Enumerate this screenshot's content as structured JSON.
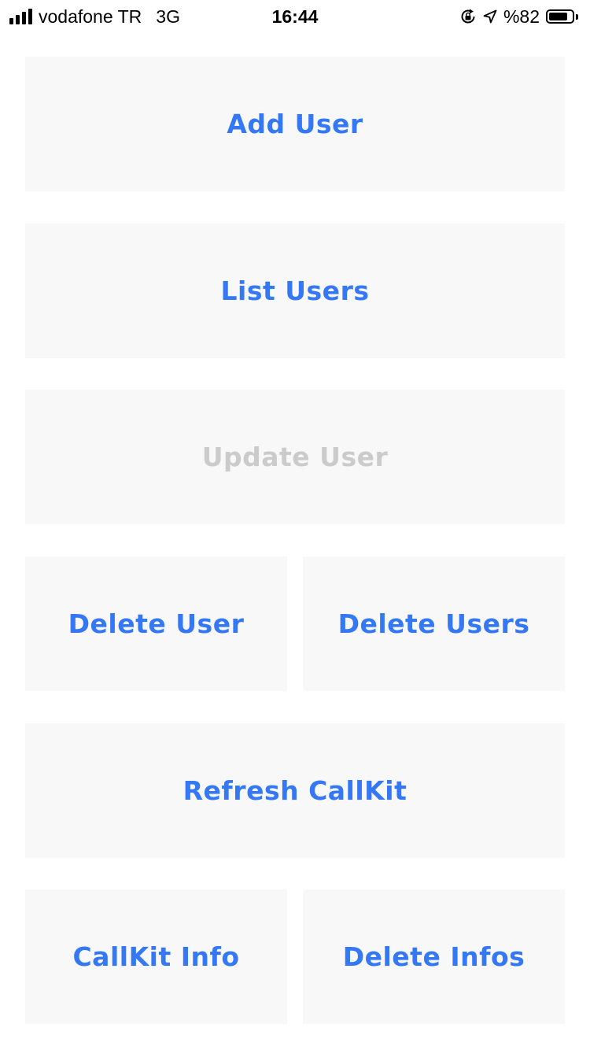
{
  "status_bar": {
    "carrier": "vodafone TR",
    "network": "3G",
    "time": "16:44",
    "battery_text": "%82",
    "battery_level": 0.82,
    "signal_bars": 4,
    "icons": [
      "signal-strength-icon",
      "rotation-lock-icon",
      "location-arrow-icon",
      "battery-icon"
    ]
  },
  "colors": {
    "accent": "#3478f6",
    "disabled": "#cbcbcb",
    "button_background": "#f8f8f8",
    "background": "#ffffff"
  },
  "buttons": {
    "add_user": {
      "label": "Add User",
      "enabled": true
    },
    "list_users": {
      "label": "List Users",
      "enabled": true
    },
    "update_user": {
      "label": "Update User",
      "enabled": false
    },
    "delete_user": {
      "label": "Delete User",
      "enabled": true
    },
    "delete_users": {
      "label": "Delete Users",
      "enabled": true
    },
    "refresh_callkit": {
      "label": "Refresh CallKit",
      "enabled": true
    },
    "callkit_info": {
      "label": "CallKit Info",
      "enabled": true
    },
    "delete_infos": {
      "label": "Delete Infos",
      "enabled": true
    }
  }
}
